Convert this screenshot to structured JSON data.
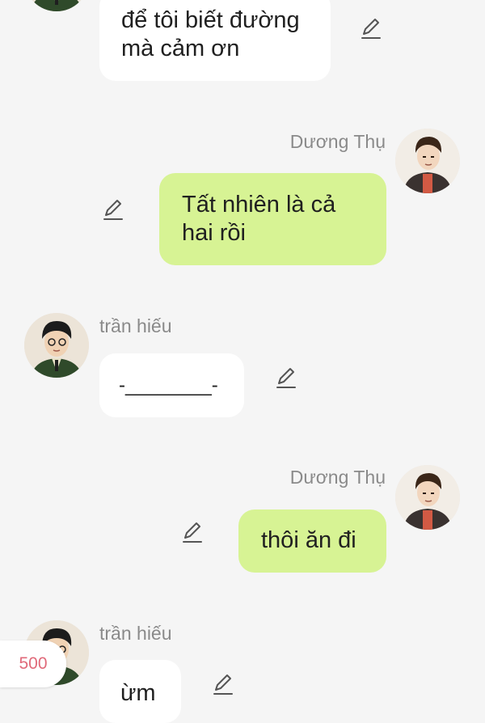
{
  "messages": [
    {
      "id": "m1",
      "direction": "in",
      "sender": "",
      "text": "để tôi biết đường\nmà cảm ơn"
    },
    {
      "id": "m2",
      "direction": "out",
      "sender": "Dương Thụ",
      "text": "Tất nhiên là cả\nhai rồi"
    },
    {
      "id": "m3",
      "direction": "in",
      "sender": "trần hiếu",
      "text": "-________-"
    },
    {
      "id": "m4",
      "direction": "out",
      "sender": "Dương Thụ",
      "text": "thôi ăn đi"
    },
    {
      "id": "m5",
      "direction": "in",
      "sender": "trần hiếu",
      "text": "ừm"
    }
  ],
  "counter": {
    "value": "500"
  },
  "icons": {
    "edit": "pencil-edit-icon"
  },
  "colors": {
    "outgoing_bubble": "#d7f394",
    "incoming_bubble": "#ffffff",
    "name": "#8a8a8a",
    "counter_text": "#e06a7a"
  }
}
